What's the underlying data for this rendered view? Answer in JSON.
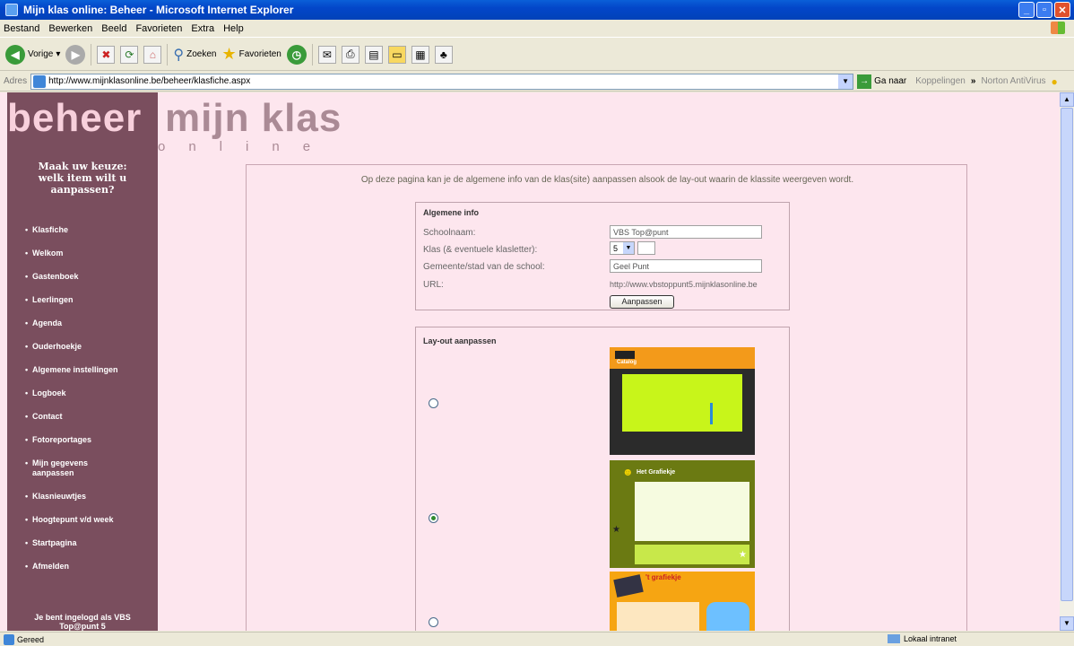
{
  "window": {
    "title": "Mijn klas online: Beheer - Microsoft Internet Explorer"
  },
  "menu": [
    "Bestand",
    "Bewerken",
    "Beeld",
    "Favorieten",
    "Extra",
    "Help"
  ],
  "toolbar": {
    "back": "Vorige",
    "search": "Zoeken",
    "favorites": "Favorieten"
  },
  "address": {
    "label": "Adres",
    "url": "http://www.mijnklasonline.be/beheer/klasfiche.aspx",
    "go": "Ga naar",
    "links": "Koppelingen",
    "chevron": "»",
    "antivirus": "Norton AntiVirus"
  },
  "logo": {
    "word1": "beheer",
    "word2": "mijn klas",
    "sub": "online"
  },
  "sidebar": {
    "heading_line1": "Maak uw keuze:",
    "heading_line2": "welk item wilt u aanpassen?",
    "items": [
      "Klasfiche",
      "Welkom",
      "Gastenboek",
      "Leerlingen",
      "Agenda",
      "Ouderhoekje",
      "Algemene instellingen",
      "Logboek",
      "Contact",
      "Fotoreportages",
      "Mijn gegevens aanpassen",
      "Klasnieuwtjes",
      "Hoogtepunt v/d week",
      "Startpagina",
      "Afmelden"
    ],
    "logged_in_line1": "Je bent ingelogd als VBS",
    "logged_in_line2": "Top@punt 5"
  },
  "main": {
    "intro": "Op deze pagina kan je de algemene info van de klas(site) aanpassen alsook de lay-out waarin de klassite weergeven wordt.",
    "general": {
      "title": "Algemene info",
      "school_label": "Schoolnaam:",
      "school_value": "VBS Top@punt",
      "class_label": "Klas (& eventuele klasletter):",
      "class_value": "5",
      "city_label": "Gemeente/stad van de school:",
      "city_value": "Geel Punt",
      "url_label": "URL:",
      "url_value": "http://www.vbstoppunt5.mijnklasonline.be",
      "submit": "Aanpassen"
    },
    "layout": {
      "title": "Lay-out aanpassen",
      "options": [
        {
          "selected": false,
          "banner": "Catalog"
        },
        {
          "selected": true,
          "banner": "Het Grafiekje"
        },
        {
          "selected": false,
          "banner": "'t grafiekje"
        }
      ]
    }
  },
  "status": {
    "left": "Gereed",
    "zone": "Lokaal intranet"
  },
  "colors": {
    "sidebar": "#7a4e5e",
    "page": "#fde6ee",
    "titlebar": "#0346c9"
  }
}
